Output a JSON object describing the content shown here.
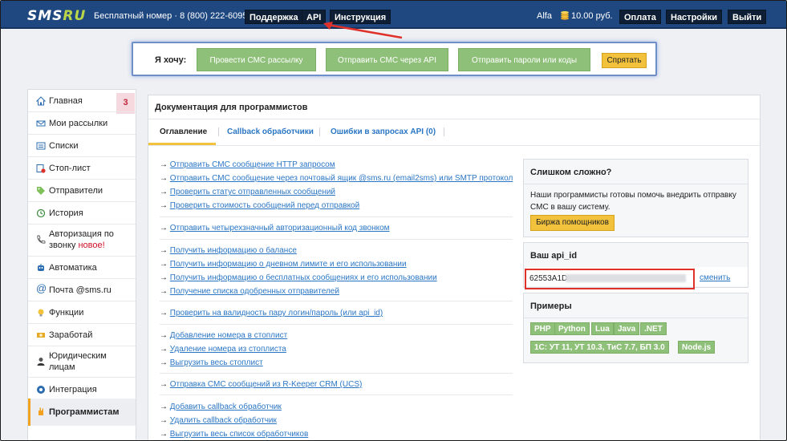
{
  "topbar": {
    "logo_main": "SMS",
    "logo_ru": "RU",
    "free_number": "Бесплатный номер · 8 (800) 222-6095",
    "support": "Поддержка",
    "api": "API",
    "instructions": "Инструкция",
    "user": "Alfa",
    "balance": "10.00 руб.",
    "pay": "Оплата",
    "settings": "Настройки",
    "exit": "Выйти"
  },
  "wishbar": {
    "label": "Я хочу:",
    "mass": "Провести СМС рассылку",
    "email": "Отправить СМС через API",
    "pass": "Отправить пароли или коды",
    "hide": "Спрятать"
  },
  "sidebar": {
    "badge": "3",
    "items": [
      {
        "label": "Главная",
        "icon": "home-icon"
      },
      {
        "label": "Мои рассылки",
        "icon": "mailing-icon"
      },
      {
        "label": "Списки",
        "icon": "list-icon"
      },
      {
        "label": "Стоп-лист",
        "icon": "stoplist-icon"
      },
      {
        "label": "Отправители",
        "icon": "tag-icon"
      },
      {
        "label": "История",
        "icon": "history-icon"
      },
      {
        "label": "Авторизация по",
        "label2": "звонку",
        "new": "новое!",
        "icon": "phone-icon"
      },
      {
        "label": "Автоматика",
        "icon": "robot-icon"
      },
      {
        "label": "Почта @sms.ru",
        "icon": "at-icon"
      },
      {
        "label": "Функции",
        "icon": "bulb-icon"
      },
      {
        "label": "Заработай",
        "icon": "money-icon"
      },
      {
        "label": "Юридическим",
        "label2": "лицам",
        "icon": "person-icon"
      },
      {
        "label": "Интеграция",
        "icon": "integration-icon"
      },
      {
        "label": "Программистам",
        "icon": "hand-icon"
      }
    ]
  },
  "main": {
    "title": "Документация для программистов",
    "tabs": {
      "toc": "Оглавление",
      "callback": "Callback обработчики",
      "errors": "Ошибки в запросах API (0)"
    },
    "arrow": "→",
    "links": [
      "Отправить СМС сообщение HTTP запросом",
      "Отправить СМС сообщение через почтовый ящик @sms.ru (email2sms) или SMTP протокол",
      "Проверить статус отправленных сообщений",
      "Проверить стоимость сообщений перед отправкой",
      "Отправить четырехзначный авторизационный код звонком",
      "Получить информацию о балансе",
      "Получить информацию о дневном лимите и его использовании",
      "Получить информацию о бесплатных сообщениях и его использовании",
      "Получение списка одобренных отправителей",
      "Проверить на валидность пару логин/пароль (или api_id)",
      "Добавление номера в стоплист",
      "Удаление номера из стоплиста",
      "Выгрузить весь стоплист",
      "Отправка СМС сообщений из R-Keeper CRM (UCS)",
      "Добавить callback обработчик",
      "Удалить callback обработчик",
      "Выгрузить весь список обработчиков"
    ]
  },
  "help": {
    "title": "Слишком сложно?",
    "text": "Наши программисты готовы помочь внедрить отправку СМС в вашу систему.",
    "button": "Биржа помощников"
  },
  "apiid": {
    "title": "Ваш api_id",
    "value": "62553A1D-",
    "change": "сменить"
  },
  "examples": {
    "title": "Примеры",
    "langs": [
      "PHP",
      "Python",
      "Lua",
      "Java",
      ".NET",
      "1С: УТ 11, УТ 10.3, ТиС 7.7, БП 3.0",
      "Node.js"
    ]
  },
  "colors": {
    "topbar": "#1f4880",
    "green": "#8fc07a",
    "yellow": "#f2c23c",
    "link": "#2a76c5",
    "highlight": "#e0302a"
  }
}
